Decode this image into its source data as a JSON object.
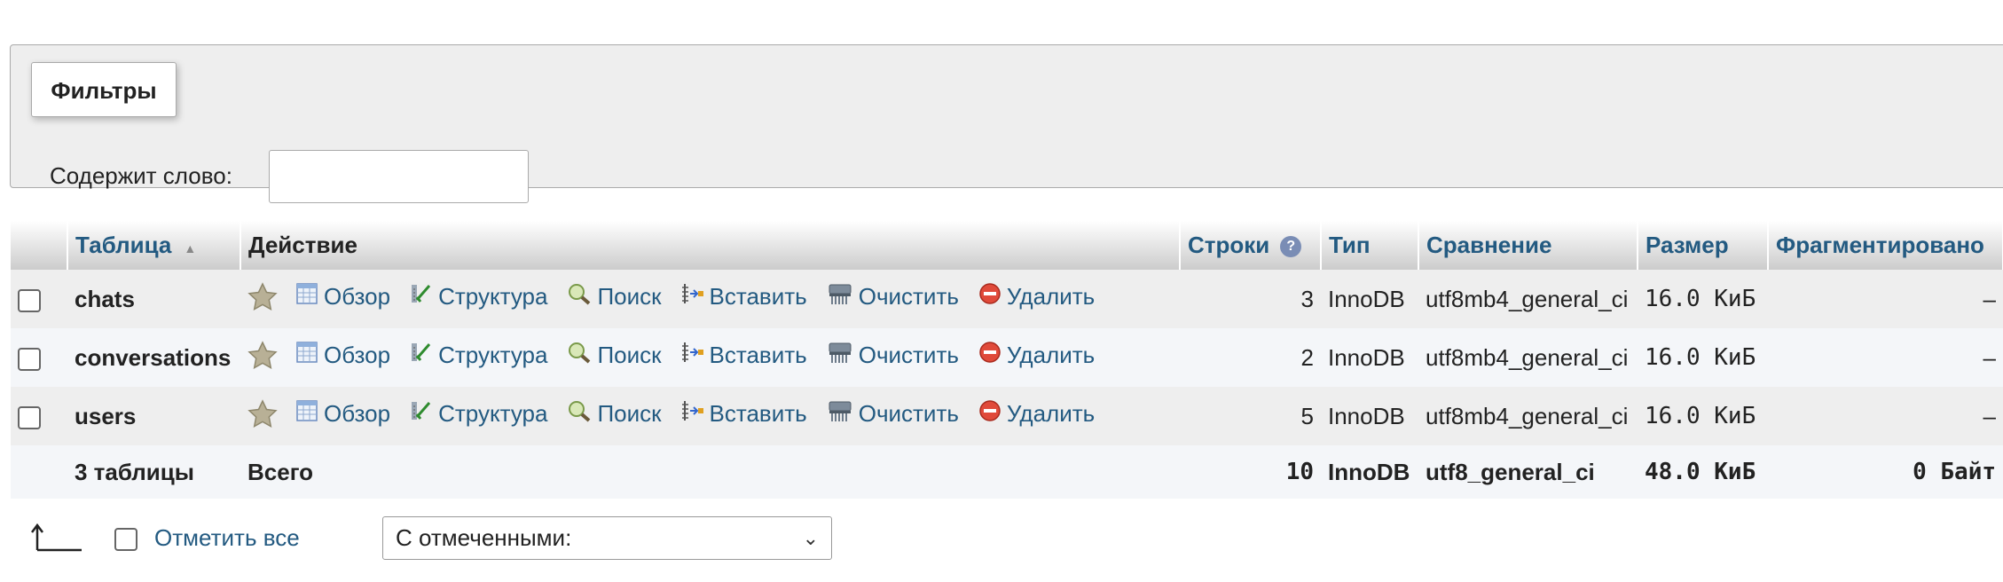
{
  "filters": {
    "legend": "Фильтры",
    "contains_label": "Содержит слово:",
    "input_value": ""
  },
  "table": {
    "headers": {
      "table": "Таблица",
      "action": "Действие",
      "rows": "Строки",
      "type": "Тип",
      "collation": "Сравнение",
      "size": "Размер",
      "overhead": "Фрагментировано"
    },
    "actions": {
      "browse": "Обзор",
      "structure": "Структура",
      "search": "Поиск",
      "insert": "Вставить",
      "empty": "Очистить",
      "drop": "Удалить"
    },
    "rows": [
      {
        "name": "chats",
        "rows": "3",
        "type": "InnoDB",
        "collation": "utf8mb4_general_ci",
        "size": "16.0 КиБ",
        "overhead": "–"
      },
      {
        "name": "conversations",
        "rows": "2",
        "type": "InnoDB",
        "collation": "utf8mb4_general_ci",
        "size": "16.0 КиБ",
        "overhead": "–"
      },
      {
        "name": "users",
        "rows": "5",
        "type": "InnoDB",
        "collation": "utf8mb4_general_ci",
        "size": "16.0 КиБ",
        "overhead": "–"
      }
    ],
    "footer": {
      "count": "3 таблицы",
      "total_label": "Всего",
      "rows": "10",
      "type": "InnoDB",
      "collation": "utf8_general_ci",
      "size": "48.0 КиБ",
      "overhead": "0 Байт"
    }
  },
  "bottom": {
    "check_all": "Отметить все",
    "with_selected": "С отмеченными:"
  },
  "colors": {
    "link": "#235a81",
    "panel_bg": "#eeeeee",
    "row_alt_bg": "#f4f6f9"
  }
}
